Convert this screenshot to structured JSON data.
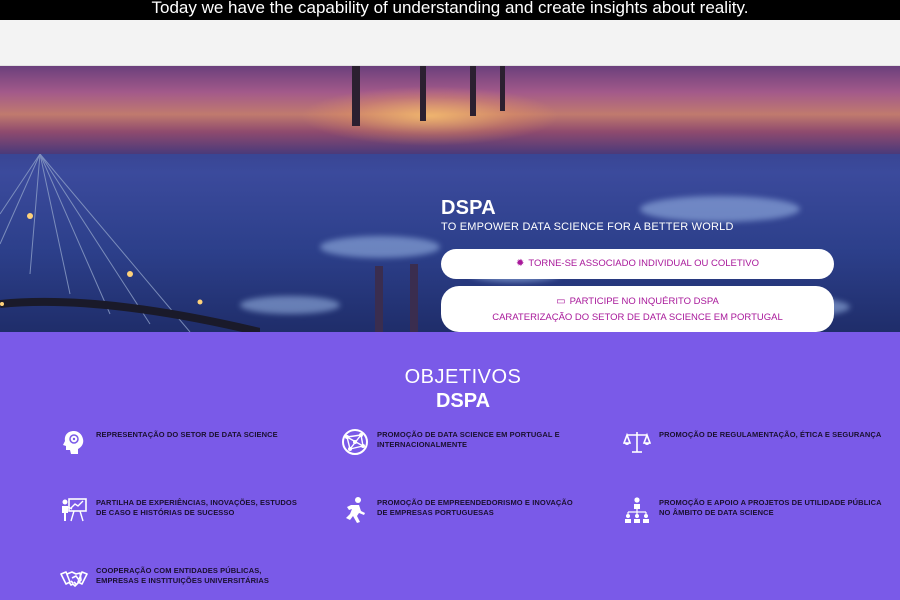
{
  "top_bar": {
    "text": "Today we have the capability of understanding and create insights about reality."
  },
  "hero": {
    "title": "DSPA",
    "subtitle": "TO EMPOWER DATA SCIENCE FOR A BETTER WORLD",
    "cta_primary": {
      "icon": "bug-icon",
      "label": "TORNE-SE ASSOCIADO INDIVIDUAL OU COLETIVO"
    },
    "cta_survey": {
      "icon": "card-icon",
      "line1": "PARTICIPE NO INQUÉRITO DSPA",
      "line2": "CARATERIZAÇÃO DO SETOR DE DATA SCIENCE EM PORTUGAL"
    },
    "accent_color": "#a8189a"
  },
  "objectives": {
    "heading_line1": "OBJETIVOS",
    "heading_line2": "DSPA",
    "background_color": "#7a5ae8",
    "items": [
      {
        "icon": "brain-head-icon",
        "text": "REPRESENTAÇÃO DO SETOR DE DATA SCIENCE"
      },
      {
        "icon": "globe-network-icon",
        "text": "PROMOÇÃO DE DATA SCIENCE EM PORTUGAL E INTERNACIONALMENTE"
      },
      {
        "icon": "scales-icon",
        "text": "PROMOÇÃO DE REGULAMENTAÇÃO, ÉTICA E SEGURANÇA"
      },
      {
        "icon": "presentation-icon",
        "text": "PARTILHA DE EXPERIÊNCIAS, INOVAÇÕES, ESTUDOS DE CASO E HISTÓRIAS DE SUCESSO"
      },
      {
        "icon": "running-person-icon",
        "text": "PROMOÇÃO DE EMPREENDEDORISMO E INOVAÇÃO DE EMPRESAS PORTUGUESAS"
      },
      {
        "icon": "team-icon",
        "text": "PROMOÇÃO E APOIO A PROJETOS DE UTILIDADE PÚBLICA NO ÂMBITO DE DATA SCIENCE"
      },
      {
        "icon": "handshake-icon",
        "text": "COOPERAÇÃO COM ENTIDADES PÚBLICAS, EMPRESAS E INSTITUIÇÕES UNIVERSITÁRIAS"
      }
    ]
  }
}
